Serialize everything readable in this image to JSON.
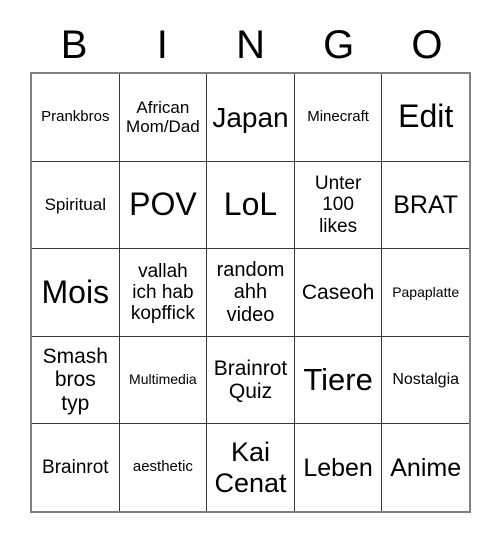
{
  "card": {
    "title": "BINGO",
    "header_letters": [
      "B",
      "I",
      "N",
      "G",
      "O"
    ],
    "grid_size": "5x5",
    "colors": {
      "background": "#ffffff",
      "text": "#000000",
      "outer_border": "#808080",
      "inner_border": "#3a3a3a"
    },
    "rows": [
      {
        "cells": [
          {
            "text": "Prankbros",
            "font_size": "15px"
          },
          {
            "text": "African\nMom/Dad",
            "font_size": "17px"
          },
          {
            "text": "Japan",
            "font_size": "28px"
          },
          {
            "text": "Minecraft",
            "font_size": "15px"
          },
          {
            "text": "Edit",
            "font_size": "32px"
          }
        ]
      },
      {
        "cells": [
          {
            "text": "Spiritual",
            "font_size": "17px"
          },
          {
            "text": "POV",
            "font_size": "32px"
          },
          {
            "text": "LoL",
            "font_size": "32px"
          },
          {
            "text": "Unter\n100\nlikes",
            "font_size": "19px"
          },
          {
            "text": "BRAT",
            "font_size": "25px"
          }
        ]
      },
      {
        "cells": [
          {
            "text": "Mois",
            "font_size": "32px"
          },
          {
            "text": "vallah\nich hab\nkopffick",
            "font_size": "19px"
          },
          {
            "text": "random\nahh\nvideo",
            "font_size": "20px"
          },
          {
            "text": "Caseoh",
            "font_size": "21px"
          },
          {
            "text": "Papaplatte",
            "font_size": "14px"
          }
        ]
      },
      {
        "cells": [
          {
            "text": "Smash\nbros\ntyp",
            "font_size": "21px"
          },
          {
            "text": "Multimedia",
            "font_size": "14px"
          },
          {
            "text": "Brainrot\nQuiz",
            "font_size": "21px"
          },
          {
            "text": "Tiere",
            "font_size": "31px"
          },
          {
            "text": "Nostalgia",
            "font_size": "16px"
          }
        ]
      },
      {
        "cells": [
          {
            "text": "Brainrot",
            "font_size": "19px"
          },
          {
            "text": "aesthetic",
            "font_size": "15px"
          },
          {
            "text": "Kai\nCenat",
            "font_size": "27px"
          },
          {
            "text": "Leben",
            "font_size": "25px"
          },
          {
            "text": "Anime",
            "font_size": "25px"
          }
        ]
      }
    ]
  }
}
